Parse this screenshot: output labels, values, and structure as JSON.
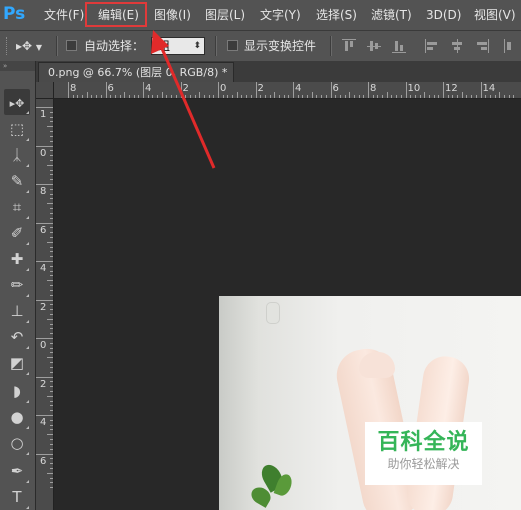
{
  "app": {
    "logo": "Ps"
  },
  "menu": [
    {
      "id": "file",
      "label": "文件(F)"
    },
    {
      "id": "edit",
      "label": "编辑(E)"
    },
    {
      "id": "image",
      "label": "图像(I)"
    },
    {
      "id": "layer",
      "label": "图层(L)"
    },
    {
      "id": "type",
      "label": "文字(Y)"
    },
    {
      "id": "select",
      "label": "选择(S)"
    },
    {
      "id": "filter",
      "label": "滤镜(T)"
    },
    {
      "id": "3d",
      "label": "3D(D)"
    },
    {
      "id": "view",
      "label": "视图(V)"
    }
  ],
  "options": {
    "auto_select_label": "自动选择：",
    "auto_select_checked": false,
    "auto_select_value": "组",
    "show_transform_label": "显示变换控件",
    "show_transform_checked": false
  },
  "document": {
    "tab_title": "0.png @ 66.7% (图层 0, RGB/8) *"
  },
  "ruler": {
    "h_labels": [
      "8",
      "6",
      "4",
      "2",
      "0",
      "2",
      "4",
      "6",
      "8",
      "10",
      "12",
      "14"
    ],
    "v_labels": [
      "1",
      "0",
      "8",
      "6",
      "4",
      "2",
      "0",
      "2",
      "4",
      "6"
    ]
  },
  "tools": [
    {
      "name": "move-tool",
      "glyph": "▸✥",
      "active": true
    },
    {
      "name": "marquee-tool",
      "glyph": "⬚"
    },
    {
      "name": "lasso-tool",
      "glyph": "ᛣ"
    },
    {
      "name": "quick-select-tool",
      "glyph": "✎"
    },
    {
      "name": "crop-tool",
      "glyph": "⌗"
    },
    {
      "name": "eyedropper-tool",
      "glyph": "✐"
    },
    {
      "name": "healing-brush-tool",
      "glyph": "✚"
    },
    {
      "name": "brush-tool",
      "glyph": "✏"
    },
    {
      "name": "clone-stamp-tool",
      "glyph": "⊥"
    },
    {
      "name": "history-brush-tool",
      "glyph": "↶"
    },
    {
      "name": "eraser-tool",
      "glyph": "◩"
    },
    {
      "name": "paint-bucket-tool",
      "glyph": "◗"
    },
    {
      "name": "blur-tool",
      "glyph": "●"
    },
    {
      "name": "dodge-tool",
      "glyph": "○"
    },
    {
      "name": "pen-tool",
      "glyph": "✒"
    },
    {
      "name": "type-tool",
      "glyph": "T"
    }
  ],
  "watermark": {
    "title": "百科全说",
    "subtitle": "助你轻松解决"
  },
  "colors": {
    "highlight": "#e03a3a",
    "ps_blue": "#31a8ff",
    "watermark_green": "#35b558"
  }
}
